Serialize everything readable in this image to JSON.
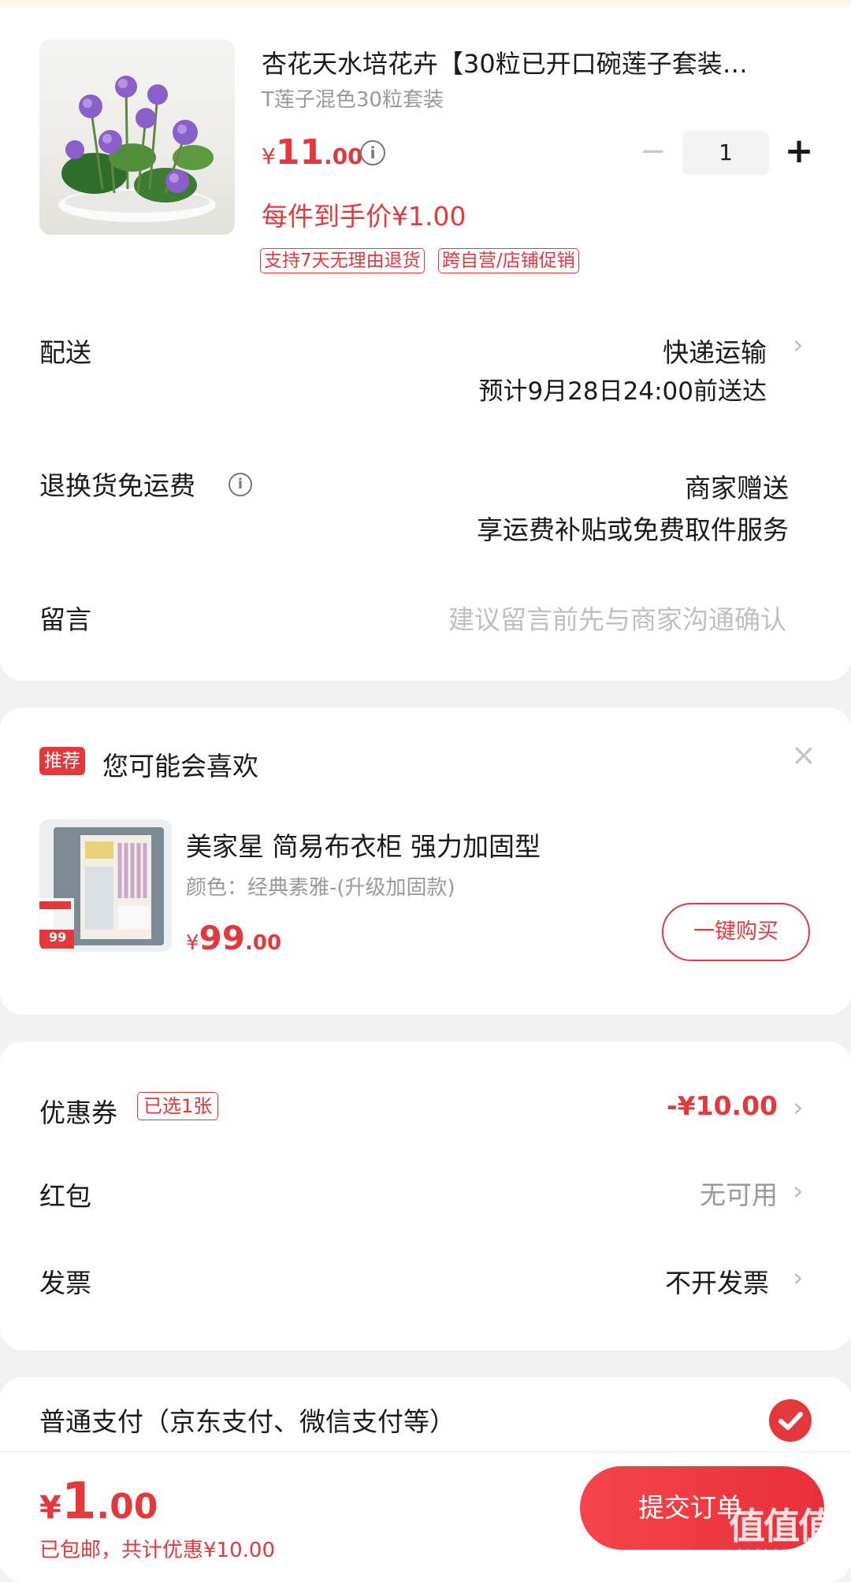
{
  "product": {
    "title": "杏花天水培花卉【30粒已开口碗莲子套装…",
    "spec": "T莲子混色30粒套装",
    "price_symbol": "¥",
    "price_int": "11",
    "price_dec": ".00",
    "final_price": "每件到手价¥1.00",
    "quantity": "1",
    "tags": [
      "支持7天无理由退货",
      "跨自营/店铺促销"
    ]
  },
  "delivery": {
    "label": "配送",
    "method": "快递运输",
    "eta": "预计9月28日24:00前送达"
  },
  "return_shipping": {
    "label": "退换货免运费",
    "value": "商家赠送",
    "desc": "享运费补贴或免费取件服务"
  },
  "message": {
    "label": "留言",
    "placeholder": "建议留言前先与商家沟通确认"
  },
  "recommend": {
    "badge": "推荐",
    "title": "您可能会喜欢",
    "item_title": "美家星 简易布衣柜 强力加固型",
    "item_spec": "颜色：经典素雅-(升级加固款)",
    "price_symbol": "¥",
    "price_int": "99",
    "price_dec": ".00",
    "buy_label": "一键购买",
    "thumb_badge": "99"
  },
  "discounts": {
    "coupon_label": "优惠券",
    "coupon_tag": "已选1张",
    "coupon_value": "-¥10.00",
    "redpacket_label": "红包",
    "redpacket_value": "无可用",
    "invoice_label": "发票",
    "invoice_value": "不开发票"
  },
  "payment": {
    "label": "普通支付（京东支付、微信支付等）"
  },
  "footer": {
    "total_symbol": "¥",
    "total_int": "1",
    "total_dec": ".00",
    "shipping_note": "已包邮",
    "saving_note": "，共计优惠¥10.00",
    "submit_label": "提交订单",
    "watermark": "值值值",
    "watermark_url": "zhizhizhi.com"
  },
  "colors": {
    "accent": "#e4393c",
    "background": "#f2f2f2"
  }
}
